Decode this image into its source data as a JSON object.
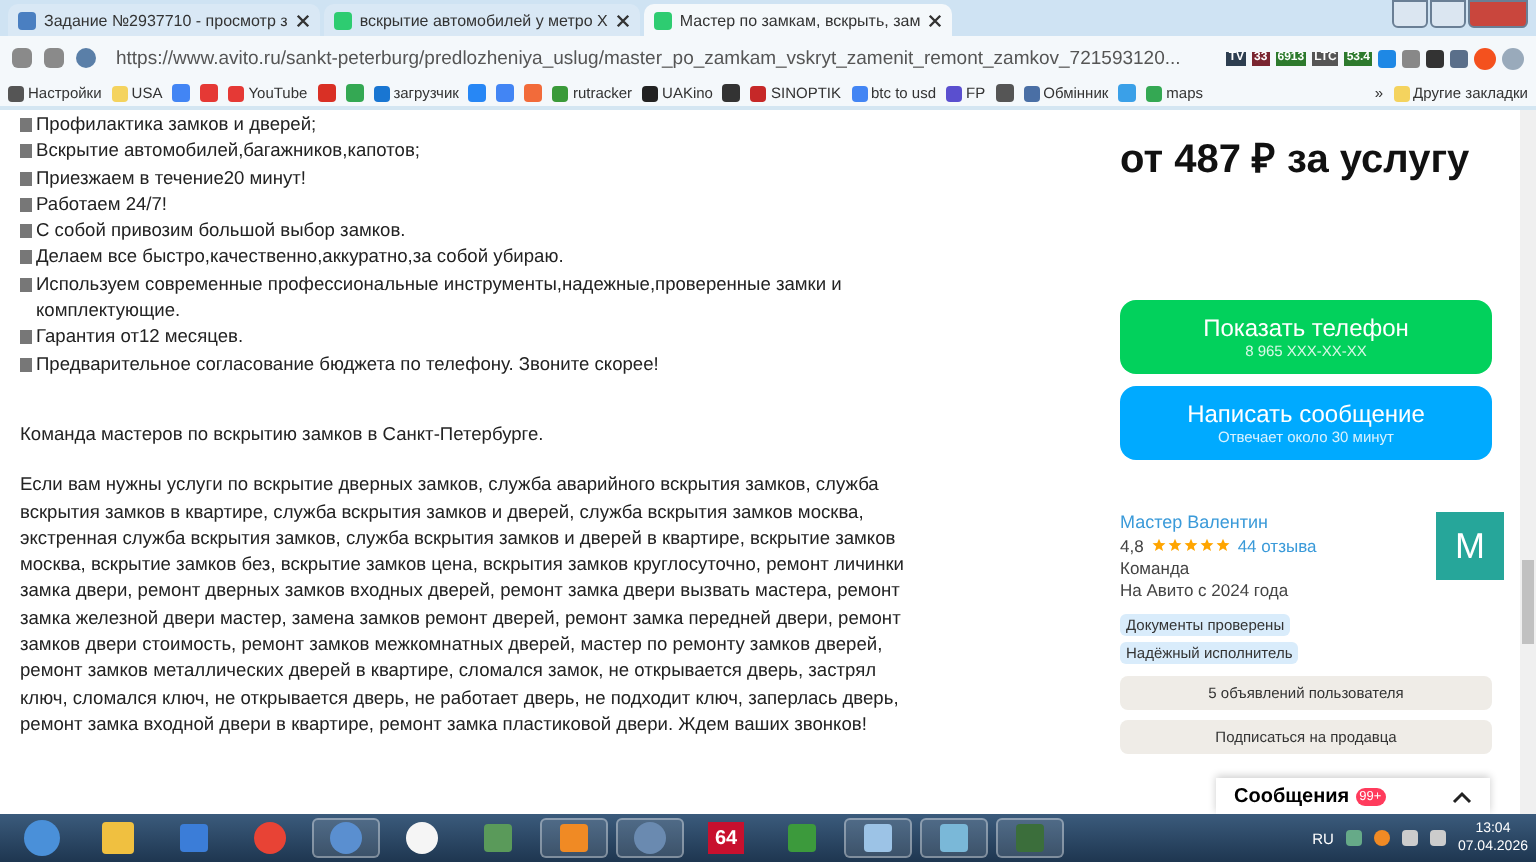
{
  "browser": {
    "tabs": [
      {
        "title": "Задание №2937710 - просмотр з",
        "selected": false
      },
      {
        "title": "вскрытие автомобилей у метро Х",
        "selected": false
      },
      {
        "title": "Мастер по замкам, вскрыть, зам",
        "selected": true
      }
    ],
    "url": "https://www.avito.ru/sankt-peterburg/predlozheniya_uslug/master_po_zamkam_vskryt_zamenit_remont_zamkov_721593120...",
    "extension_badges": [
      "TV",
      "33",
      "6913",
      "LTC",
      "53.4"
    ],
    "bookmarks": [
      {
        "kind": "link",
        "label": "Настройки"
      },
      {
        "kind": "link",
        "label": "USA"
      },
      {
        "kind": "icon"
      },
      {
        "kind": "icon"
      },
      {
        "kind": "link",
        "label": "YouTube"
      },
      {
        "kind": "icon"
      },
      {
        "kind": "icon"
      },
      {
        "kind": "link",
        "label": "загрузчик"
      },
      {
        "kind": "icon"
      },
      {
        "kind": "icon"
      },
      {
        "kind": "icon"
      },
      {
        "kind": "link",
        "label": "rutracker"
      },
      {
        "kind": "link",
        "label": "UAKino"
      },
      {
        "kind": "icon"
      },
      {
        "kind": "link",
        "label": "SINOPTIK"
      },
      {
        "kind": "link",
        "label": "btc to usd"
      },
      {
        "kind": "link",
        "label": "FP"
      },
      {
        "kind": "icon"
      },
      {
        "kind": "link",
        "label": "Обмінник"
      },
      {
        "kind": "icon"
      },
      {
        "kind": "link",
        "label": "maps"
      }
    ],
    "more": "»",
    "other_bookmarks": "Другие закладки"
  },
  "listing": {
    "features": [
      "Профилактика замков и дверей;",
      "Вскрытие автомобилей,багажников,капотов;",
      "Приезжаем в течение20 минут!",
      "Работаем 24/7!",
      "С собой привозим большой выбор замков.",
      "Делаем все быстро,качественно,аккуратно,за собой убираю.",
      "Используем современные профессиональные инструменты,надежные,проверенные замки и комплектующие.",
      "Гарантия от12 месяцев.",
      "Предварительное согласование бюджета по телефону. Звоните скорее!"
    ],
    "team_line": "Команда мастеров по вскрытию замков в Санкт-Петербурге.",
    "description": "Если вам нужны услуги по вскрытие дверных замков, служба аварийного вскрытия замков, служба вскрытия замков в квартире, служба вскрытия замков и дверей, служба вскрытия замков москва, экстренная служба вскрытия замков, служба вскрытия замков и дверей в квартире, вскрытие замков москва, вскрытие замков без, вскрытие замков цена, вскрытия замков круглосуточно, ремонт личинки замка двери, ремонт дверных замков входных дверей, ремонт замка двери вызвать мастера, ремонт замка железной двери мастер, замена замков ремонт дверей, ремонт замка передней двери, ремонт замков двери стоимость, ремонт замков межкомнатных дверей, мастер по ремонту замков дверей, ремонт замков металлических дверей в квартире, сломался замок, не открывается дверь, застрял ключ, сломался ключ, не открывается дверь, не работает дверь, не подходит ключ, заперлась дверь, ремонт замка входной двери в квартире, ремонт замка пластиковой двери. Ждем ваших звонков!"
  },
  "sidebar": {
    "price": "от 487 ₽ за услугу",
    "phone_button": {
      "title": "Показать телефон",
      "subtitle": "8 965 XXX-XX-XX"
    },
    "message_button": {
      "title": "Написать сообщение",
      "subtitle": "Отвечает около 30 минут"
    },
    "seller": {
      "name": "Мастер Валентин",
      "rating": "4,8",
      "stars": 5,
      "reviews": "44 отзыва",
      "type": "Команда",
      "since": "На Авито с 2024 года",
      "avatar_letter": "M"
    },
    "badges": [
      "Документы проверены",
      "Надёжный исполнитель"
    ],
    "actions": [
      "5 объявлений пользователя",
      "Подписаться на продавца"
    ],
    "messenger": {
      "title": "Сообщения",
      "count": "99+"
    }
  },
  "taskbar": {
    "app_label": "64",
    "language": "RU",
    "time": "13:04",
    "date": "07.04.2026"
  }
}
